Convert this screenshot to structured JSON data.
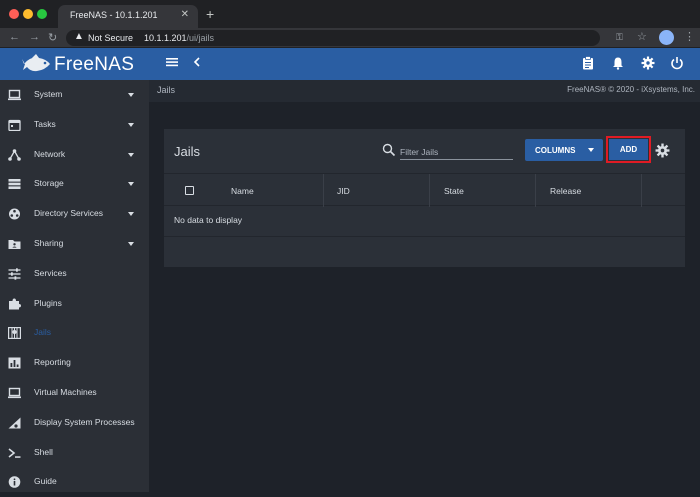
{
  "browser": {
    "tab_title": "FreeNAS - 10.1.1.201",
    "tab_close": "✕",
    "new_tab": "+",
    "security_label": "Not Secure",
    "url_host": "10.1.1.201",
    "url_path": "/ui/jails"
  },
  "topbar": {
    "logo_text": "FreeNAS",
    "brand_color": "#2a5ea3"
  },
  "header": {
    "breadcrumb": "Jails",
    "copyright": "FreeNAS® © 2020 - iXsystems, Inc."
  },
  "sidebar": {
    "items": [
      {
        "label": "System",
        "icon": "laptop-icon",
        "has_children": true
      },
      {
        "label": "Tasks",
        "icon": "calendar-icon",
        "has_children": true
      },
      {
        "label": "Network",
        "icon": "network-icon",
        "has_children": true
      },
      {
        "label": "Storage",
        "icon": "storage-icon",
        "has_children": true
      },
      {
        "label": "Directory Services",
        "icon": "directory-services-icon",
        "has_children": true
      },
      {
        "label": "Sharing",
        "icon": "folder-share-icon",
        "has_children": true
      },
      {
        "label": "Services",
        "icon": "sliders-icon",
        "has_children": false
      },
      {
        "label": "Plugins",
        "icon": "puzzle-icon",
        "has_children": false
      },
      {
        "label": "Jails",
        "icon": "jail-icon",
        "has_children": false,
        "active": true
      },
      {
        "label": "Reporting",
        "icon": "bar-chart-icon",
        "has_children": false
      },
      {
        "label": "Virtual Machines",
        "icon": "computer-icon",
        "has_children": false
      },
      {
        "label": "Display System Processes",
        "icon": "processes-icon",
        "has_children": false
      },
      {
        "label": "Shell",
        "icon": "terminal-icon",
        "has_children": false
      },
      {
        "label": "Guide",
        "icon": "info-icon",
        "has_children": false
      }
    ]
  },
  "jails_card": {
    "title": "Jails",
    "filter_placeholder": "Filter Jails",
    "columns_label": "COLUMNS",
    "add_label": "ADD",
    "columns": [
      "Name",
      "JID",
      "State",
      "Release"
    ],
    "empty_message": "No data to display"
  }
}
